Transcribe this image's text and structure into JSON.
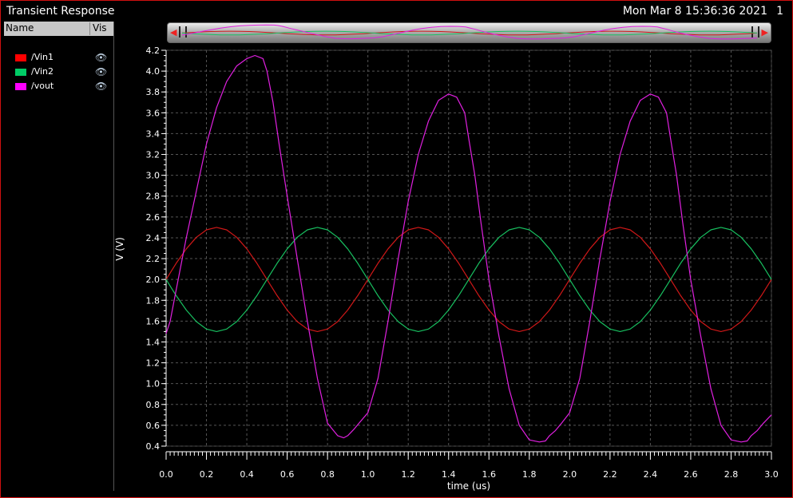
{
  "window": {
    "title": "Transient Response",
    "date": "Mon Mar 8 15:36:36 2021",
    "page_number": "1"
  },
  "legend": {
    "header_name": "Name",
    "header_vis": "Vis",
    "items": [
      {
        "label": "/Vin1",
        "color": "#ff0000",
        "icon": "eye-icon"
      },
      {
        "label": "/Vin2",
        "color": "#00cc66",
        "icon": "eye-icon"
      },
      {
        "label": "/vout",
        "color": "#ff00ff",
        "icon": "eye-icon"
      }
    ]
  },
  "chart_data": {
    "type": "line",
    "xlabel": "time (us)",
    "ylabel": "V (V)",
    "xlim": [
      0.0,
      3.0
    ],
    "ylim": [
      0.4,
      4.2
    ],
    "x_ticks": [
      "0.0",
      "0.2",
      "0.4",
      "0.6",
      "0.8",
      "1.0",
      "1.2",
      "1.4",
      "1.6",
      "1.8",
      "2.0",
      "2.2",
      "2.4",
      "2.6",
      "2.8",
      "3.0"
    ],
    "y_ticks": [
      "0.4",
      "0.6",
      "0.8",
      "1.0",
      "1.2",
      "1.4",
      "1.6",
      "1.8",
      "2.0",
      "2.2",
      "2.4",
      "2.6",
      "2.8",
      "3.0",
      "3.2",
      "3.4",
      "3.6",
      "3.8",
      "4.0",
      "4.2"
    ],
    "grid": true,
    "series": [
      {
        "name": "/Vin1",
        "color": "#d01818",
        "x": [
          0,
          0.05,
          0.1,
          0.15,
          0.2,
          0.25,
          0.3,
          0.35,
          0.4,
          0.45,
          0.5,
          0.55,
          0.6,
          0.65,
          0.7,
          0.75,
          0.8,
          0.85,
          0.9,
          0.95,
          1.0,
          1.05,
          1.1,
          1.15,
          1.2,
          1.25,
          1.3,
          1.35,
          1.4,
          1.45,
          1.5,
          1.55,
          1.6,
          1.65,
          1.7,
          1.75,
          1.8,
          1.85,
          1.9,
          1.95,
          2.0,
          2.05,
          2.1,
          2.15,
          2.2,
          2.25,
          2.3,
          2.35,
          2.4,
          2.45,
          2.5,
          2.55,
          2.6,
          2.65,
          2.7,
          2.75,
          2.8,
          2.85,
          2.9,
          2.95,
          3.0
        ],
        "y": [
          2.0,
          2.155,
          2.294,
          2.405,
          2.476,
          2.5,
          2.476,
          2.405,
          2.294,
          2.155,
          2.0,
          1.845,
          1.706,
          1.595,
          1.524,
          1.5,
          1.524,
          1.595,
          1.706,
          1.845,
          2.0,
          2.155,
          2.294,
          2.405,
          2.476,
          2.5,
          2.476,
          2.405,
          2.294,
          2.155,
          2.0,
          1.845,
          1.706,
          1.595,
          1.524,
          1.5,
          1.524,
          1.595,
          1.706,
          1.845,
          2.0,
          2.155,
          2.294,
          2.405,
          2.476,
          2.5,
          2.476,
          2.405,
          2.294,
          2.155,
          2.0,
          1.845,
          1.706,
          1.595,
          1.524,
          1.5,
          1.524,
          1.595,
          1.706,
          1.845,
          2.0
        ]
      },
      {
        "name": "/Vin2",
        "color": "#18c060",
        "x": [
          0,
          0.05,
          0.1,
          0.15,
          0.2,
          0.25,
          0.3,
          0.35,
          0.4,
          0.45,
          0.5,
          0.55,
          0.6,
          0.65,
          0.7,
          0.75,
          0.8,
          0.85,
          0.9,
          0.95,
          1.0,
          1.05,
          1.1,
          1.15,
          1.2,
          1.25,
          1.3,
          1.35,
          1.4,
          1.45,
          1.5,
          1.55,
          1.6,
          1.65,
          1.7,
          1.75,
          1.8,
          1.85,
          1.9,
          1.95,
          2.0,
          2.05,
          2.1,
          2.15,
          2.2,
          2.25,
          2.3,
          2.35,
          2.4,
          2.45,
          2.5,
          2.55,
          2.6,
          2.65,
          2.7,
          2.75,
          2.8,
          2.85,
          2.9,
          2.95,
          3.0
        ],
        "y": [
          2.0,
          1.845,
          1.706,
          1.595,
          1.524,
          1.5,
          1.524,
          1.595,
          1.706,
          1.845,
          2.0,
          2.155,
          2.294,
          2.405,
          2.476,
          2.5,
          2.476,
          2.405,
          2.294,
          2.155,
          2.0,
          1.845,
          1.706,
          1.595,
          1.524,
          1.5,
          1.524,
          1.595,
          1.706,
          1.845,
          2.0,
          2.155,
          2.294,
          2.405,
          2.476,
          2.5,
          2.476,
          2.405,
          2.294,
          2.155,
          2.0,
          1.845,
          1.706,
          1.595,
          1.524,
          1.5,
          1.524,
          1.595,
          1.706,
          1.845,
          2.0,
          2.155,
          2.294,
          2.405,
          2.476,
          2.5,
          2.476,
          2.405,
          2.294,
          2.155,
          2.0
        ]
      },
      {
        "name": "/vout",
        "color": "#e020e0",
        "x": [
          0,
          0.02,
          0.05,
          0.1,
          0.15,
          0.2,
          0.25,
          0.3,
          0.35,
          0.4,
          0.44,
          0.48,
          0.5,
          0.53,
          0.56,
          0.6,
          0.65,
          0.7,
          0.75,
          0.8,
          0.85,
          0.88,
          0.9,
          0.93,
          0.96,
          1.0,
          1.05,
          1.1,
          1.15,
          1.2,
          1.25,
          1.3,
          1.35,
          1.4,
          1.44,
          1.48,
          1.5,
          1.53,
          1.56,
          1.6,
          1.65,
          1.7,
          1.75,
          1.8,
          1.85,
          1.88,
          1.9,
          1.93,
          1.96,
          2.0,
          2.05,
          2.1,
          2.15,
          2.2,
          2.25,
          2.3,
          2.35,
          2.4,
          2.44,
          2.48,
          2.5,
          2.53,
          2.56,
          2.6,
          2.65,
          2.7,
          2.75,
          2.8,
          2.85,
          2.88,
          2.9,
          2.93,
          2.96,
          3.0
        ],
        "y": [
          1.48,
          1.6,
          1.9,
          2.4,
          2.85,
          3.3,
          3.65,
          3.9,
          4.05,
          4.12,
          4.15,
          4.12,
          4.0,
          3.7,
          3.3,
          2.8,
          2.2,
          1.6,
          1.05,
          0.62,
          0.5,
          0.48,
          0.5,
          0.56,
          0.63,
          0.72,
          1.05,
          1.6,
          2.2,
          2.75,
          3.2,
          3.52,
          3.72,
          3.78,
          3.75,
          3.6,
          3.35,
          3.0,
          2.55,
          2.0,
          1.45,
          0.95,
          0.6,
          0.46,
          0.44,
          0.45,
          0.5,
          0.55,
          0.62,
          0.72,
          1.05,
          1.6,
          2.2,
          2.75,
          3.2,
          3.52,
          3.72,
          3.78,
          3.75,
          3.6,
          3.35,
          3.0,
          2.55,
          2.0,
          1.45,
          0.95,
          0.6,
          0.46,
          0.44,
          0.45,
          0.5,
          0.55,
          0.62,
          0.7
        ]
      }
    ]
  }
}
